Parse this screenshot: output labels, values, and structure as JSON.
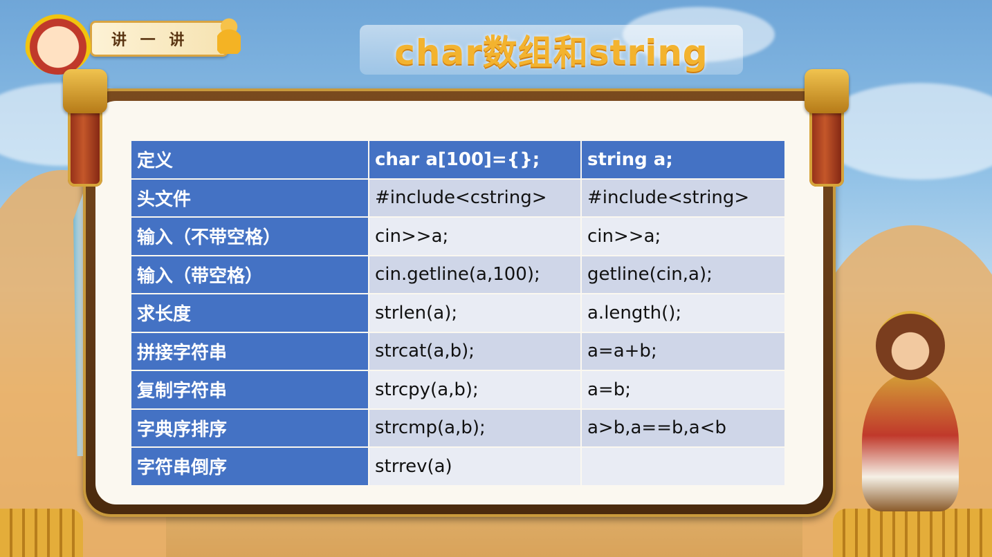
{
  "badge": {
    "text": "讲 一 讲"
  },
  "title": "char数组和string",
  "table": {
    "header": [
      "定义",
      "char a[100]={};",
      "string a;"
    ],
    "rows": [
      [
        "头文件",
        "#include<cstring>",
        "#include<string>"
      ],
      [
        "输入（不带空格）",
        "cin>>a;",
        "cin>>a;"
      ],
      [
        "输入（带空格）",
        "cin.getline(a,100);",
        "getline(cin,a);"
      ],
      [
        "求长度",
        "strlen(a);",
        "a.length();"
      ],
      [
        "拼接字符串",
        "strcat(a,b);",
        "a=a+b;"
      ],
      [
        "复制字符串",
        "strcpy(a,b);",
        "a=b;"
      ],
      [
        "字典序排序",
        "strcmp(a,b);",
        "a>b,a==b,a<b"
      ],
      [
        "字符串倒序",
        "strrev(a)",
        ""
      ]
    ]
  },
  "colors": {
    "header_blue": "#4472c4",
    "row_dark": "#cfd6e8",
    "row_light": "#e9ecf4",
    "title_gold": "#f3b32f"
  }
}
